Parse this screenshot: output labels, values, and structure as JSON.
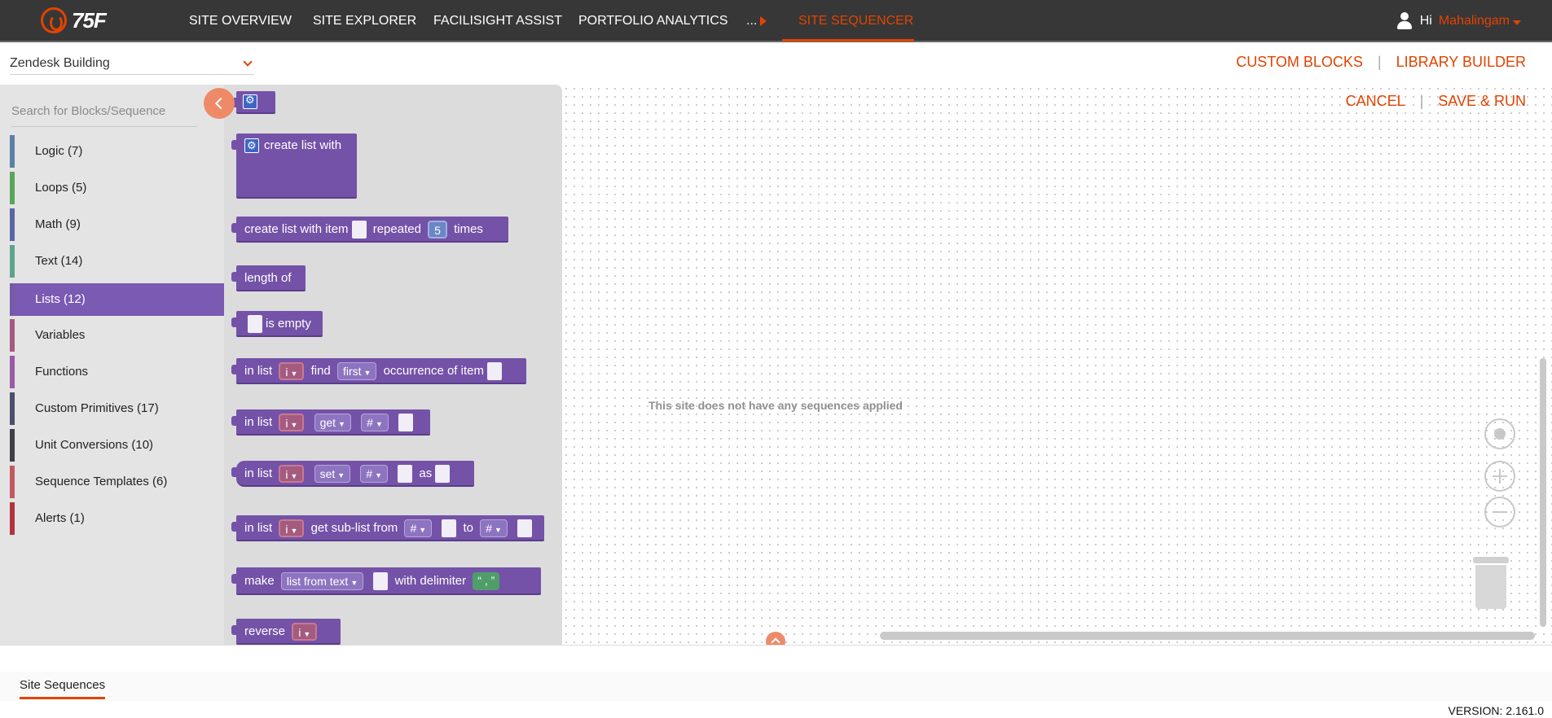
{
  "brand": {
    "logo_text": "75F",
    "accent": "#e24301"
  },
  "nav": {
    "items": [
      "SITE OVERVIEW",
      "SITE EXPLORER",
      "FACILISIGHT ASSIST",
      "PORTFOLIO ANALYTICS"
    ],
    "more": "...",
    "active": "SITE SEQUENCER"
  },
  "user": {
    "greeting": "Hi",
    "name": "Mahalingam"
  },
  "building": {
    "selected": "Zendesk Building"
  },
  "links": {
    "custom_blocks": "CUSTOM BLOCKS",
    "separator": "|",
    "library_builder": "LIBRARY BUILDER"
  },
  "actions": {
    "cancel": "CANCEL",
    "save_run": "SAVE & RUN"
  },
  "toolbox": {
    "search_placeholder": "Search for Blocks/Sequence",
    "categories": [
      {
        "label": "Logic (7)",
        "color": "#5b80a5"
      },
      {
        "label": "Loops (5)",
        "color": "#5ba55b"
      },
      {
        "label": "Math (9)",
        "color": "#5b67a5"
      },
      {
        "label": "Text (14)",
        "color": "#5ba58c"
      },
      {
        "label": "Lists (12)",
        "color": "#745ba5"
      },
      {
        "label": "Variables",
        "color": "#a55b80"
      },
      {
        "label": "Functions",
        "color": "#995ba5"
      },
      {
        "label": "Custom Primitives (17)",
        "color": "#4a4f6b"
      },
      {
        "label": "Unit Conversions (10)",
        "color": "#3f3f48"
      },
      {
        "label": "Sequence Templates (6)",
        "color": "#c05a62"
      },
      {
        "label": "Alerts (1)",
        "color": "#b3343f"
      }
    ]
  },
  "flyout": {
    "create_list_with": "create list with",
    "create_list_item": "create list with item",
    "repeated": "repeated",
    "repeat_count": "5",
    "times": "times",
    "length_of": "length of",
    "is_empty": "is empty",
    "in_list": "in list",
    "var_i": "i",
    "find": "find",
    "first": "first",
    "occurrence_of_item": "occurrence of item",
    "get": "get",
    "hash": "#",
    "set": "set",
    "as": "as",
    "get_sub_list_from": "get sub-list from",
    "to": "to",
    "make": "make",
    "list_from_text": "list from text",
    "with_delimiter": "with delimiter",
    "delimiter_value": ",",
    "quote_open": "“",
    "quote_close": "”",
    "reverse": "reverse"
  },
  "workspace": {
    "empty_message": "This site does not have any sequences applied"
  },
  "bottom": {
    "tab": "Site Sequences",
    "version": "VERSION: 2.161.0"
  }
}
